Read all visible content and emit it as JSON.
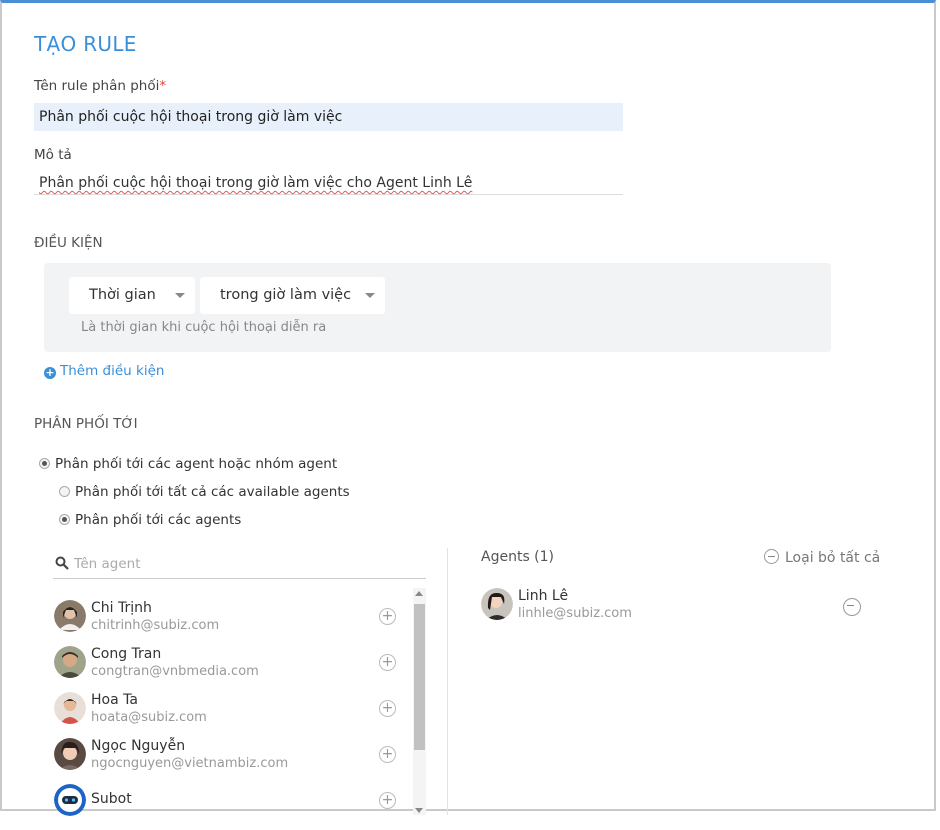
{
  "form": {
    "title": "TẠO RULE",
    "name_label": "Tên rule phân phối",
    "name_required": "*",
    "name_value": "Phân phối cuộc hội thoại trong giờ làm việc",
    "desc_label": "Mô tả",
    "desc_value": "Phân phối cuộc hội thoại trong giờ làm việc cho Agent Linh Lê"
  },
  "conditions": {
    "section_title": "ĐIỀU KIỆN",
    "field_select": "Thời gian",
    "operator_select": "trong giờ làm việc",
    "hint": "Là thời gian khi cuộc hội thoại diễn ra",
    "add_label": "Thêm điều kiện"
  },
  "distribution": {
    "section_title": "PHÂN PHỐI TỚI",
    "option_main": "Phân phối tới các agent hoặc nhóm agent",
    "option_all": "Phân phối tới tất cả các available agents",
    "option_agents": "Phân phối tới các agents"
  },
  "agent_search": {
    "placeholder": "Tên agent"
  },
  "agent_list": [
    {
      "name": "Chi Trịnh",
      "email": "chitrinh@subiz.com"
    },
    {
      "name": "Cong Tran",
      "email": "congtran@vnbmedia.com"
    },
    {
      "name": "Hoa Ta",
      "email": "hoata@subiz.com"
    },
    {
      "name": "Ngọc Nguyễn",
      "email": "ngocnguyen@vietnambiz.com"
    },
    {
      "name": "Subot",
      "email": ""
    }
  ],
  "selected": {
    "header": "Agents (1)",
    "remove_all": "Loại bỏ tất cả",
    "items": [
      {
        "name": "Linh Lê",
        "email": "linhle@subiz.com"
      }
    ]
  },
  "colors": {
    "accent": "#3b8fd9",
    "name_input_bg": "#e8f0fb",
    "condition_bg": "#f2f3f5"
  }
}
